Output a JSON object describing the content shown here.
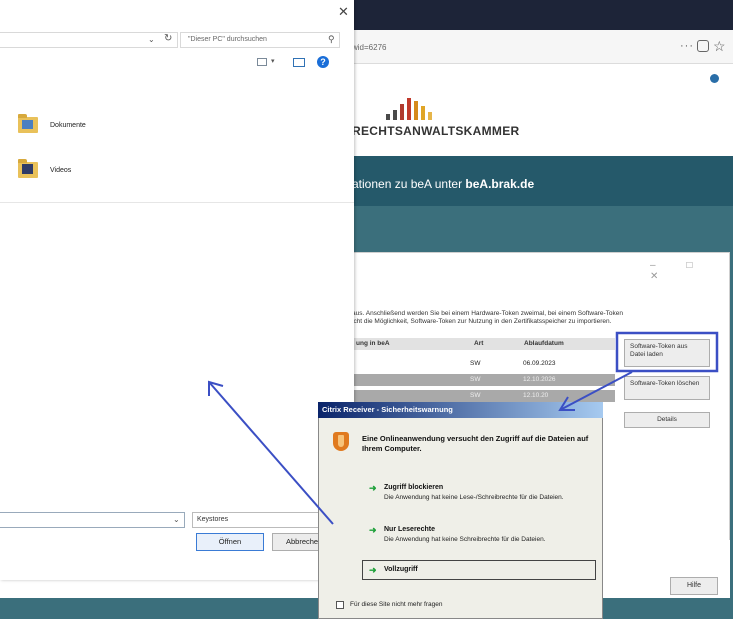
{
  "browser": {
    "url": "wid=6276",
    "menu_dots": "···",
    "star_glyph": "☆",
    "org_name": "RECHTSANWALTSKAMMER",
    "banner_text": "ationen zu beA unter ",
    "banner_link": "beA.brak.de"
  },
  "token_dialog": {
    "window_controls": "– □ ✕",
    "description": "aus. Anschließend werden Sie bei einem Hardware-Token zweimal, bei einem Software-Token\nicht die Möglichkeit, Software-Token zur Nutzung in den Zertifikatsspeicher zu importieren.",
    "columns": [
      "ung in beA",
      "Art",
      "Ablaufdatum"
    ],
    "rows": [
      {
        "art": "SW",
        "date": "06.09.2023"
      },
      {
        "art": "SW",
        "date": "12.10.2026"
      },
      {
        "art": "SW",
        "date": "12.10.20"
      }
    ],
    "btn_load": "Software-Token aus Datei laden",
    "btn_delete": "Software-Token löschen",
    "btn_details": "Details",
    "btn_help": "Hilfe"
  },
  "explorer": {
    "close_glyph": "✕",
    "search_placeholder": "\"Dieser PC\" durchsuchen",
    "help_glyph": "?",
    "folders": [
      {
        "name": "Dokumente"
      },
      {
        "name": "Videos"
      }
    ],
    "file_type": "Keystores",
    "open_label": "Öffnen",
    "cancel_label": "Abbreche"
  },
  "citrix": {
    "title": "Citrix Receiver - Sicherheitswarnung",
    "heading": "Eine Onlineanwendung versucht den Zugriff auf die Dateien auf Ihrem Computer.",
    "options": [
      {
        "title": "Zugriff blockieren",
        "desc": "Die Anwendung hat keine Lese-/Schreibrechte für die Dateien."
      },
      {
        "title": "Nur Leserechte",
        "desc": "Die Anwendung hat keine Schreibrechte für die Dateien."
      },
      {
        "title": "Vollzugriff",
        "desc": ""
      }
    ],
    "dont_ask": "Für diese Site nicht mehr fragen"
  },
  "colors": {
    "annotation": "#3b4fc4",
    "banner": "#25596a",
    "page_bg": "#3b6f7c"
  }
}
